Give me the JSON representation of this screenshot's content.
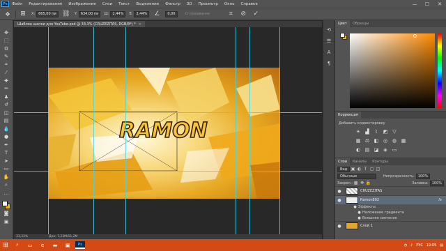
{
  "app": {
    "logo": "Ps"
  },
  "menu": [
    "Файл",
    "Редактирование",
    "Изображение",
    "Слои",
    "Текст",
    "Выделение",
    "Фильтр",
    "3D",
    "Просмотр",
    "Окно",
    "Справка"
  ],
  "window_controls": {
    "minimize": "—",
    "maximize": "☐",
    "close": "✕"
  },
  "options": {
    "x_label": "X:",
    "x_value": "665,00 пи",
    "y_label": "Y:",
    "y_value": "634,00 пи",
    "w_label": "Ш:",
    "w_value": "2,44%",
    "h_label": "В:",
    "h_value": "2,44%",
    "angle_value": "0,00",
    "interpolation": "Сглаживание",
    "icons": [
      "move-tool-icon",
      "reference-point-icon",
      "link-icon",
      "angle-icon",
      "warp-icon",
      "cancel-icon",
      "commit-icon"
    ]
  },
  "document_tab": {
    "title": "Шаблон шапки для YouTube.psd @ 33,3% (CRUZEZITAS, RGB/8*) *",
    "close": "×"
  },
  "statusbar": {
    "zoom": "33,33%",
    "doc": "Док: 7,23M/11,2M"
  },
  "panels": {
    "color_tabs": [
      "Цвет",
      "Образцы"
    ],
    "colors": {
      "foreground": "#f4f4f4",
      "background": "#f0b51a",
      "hue": "#ff8a00"
    },
    "adjustments": {
      "title": "Коррекция",
      "subtitle": "Добавить корректировку"
    },
    "layers_tabs": [
      "Слои",
      "Каналы",
      "Контуры"
    ],
    "layers_kind": "Вид",
    "blend_mode": "Обычные",
    "opacity_label": "Непрозрачность:",
    "opacity_value": "100%",
    "lock_label": "Закреп.:",
    "fill_label": "Заливка:",
    "fill_value": "100%",
    "layers": [
      {
        "name": "CRUZEZITAS",
        "thumb": "checker"
      },
      {
        "name": "Ramon802",
        "thumb": "white",
        "fx": "fx"
      }
    ],
    "effects_title": "Эффекты",
    "effects": [
      "Наложение градиента",
      "Внешнее свечение"
    ],
    "last_layer": {
      "name": "Слой 1",
      "thumb": "orange"
    }
  },
  "taskbar": {
    "tray_lang": "РУС",
    "tray_time": "19:05"
  }
}
